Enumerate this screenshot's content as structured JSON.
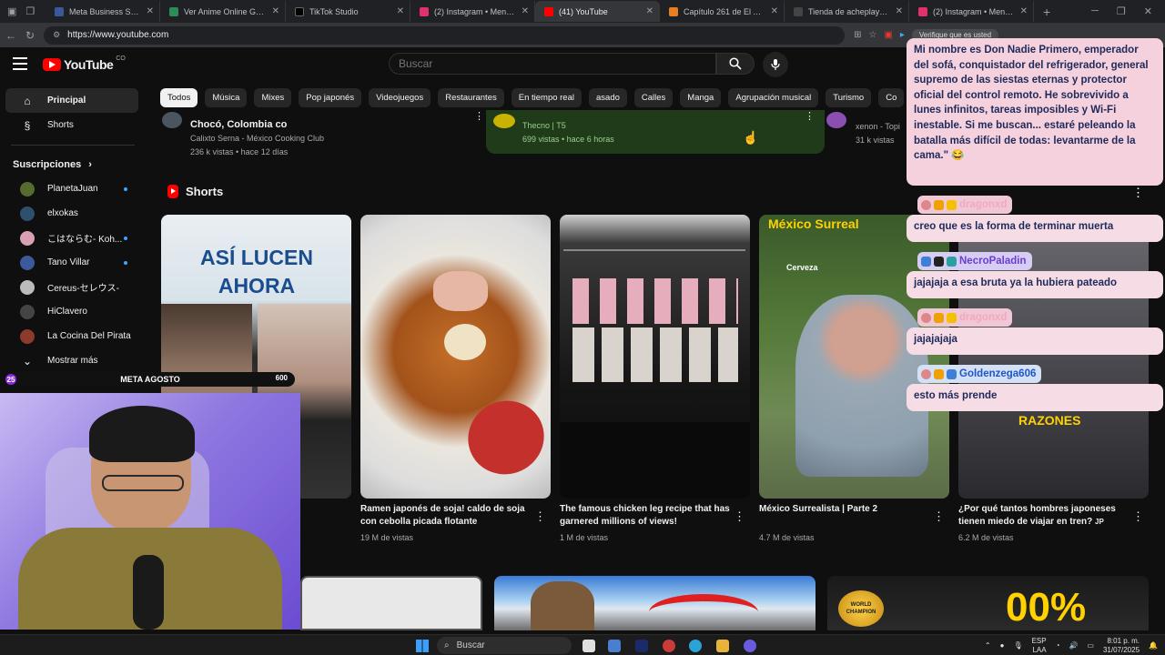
{
  "browser": {
    "tabs": [
      {
        "title": "Meta Business Suite",
        "color": "#3b5998"
      },
      {
        "title": "Ver Anime Online Gratis en",
        "color": "#2e8b57"
      },
      {
        "title": "TikTok Studio",
        "color": "#000000"
      },
      {
        "title": "(2) Instagram • Mensajes",
        "color": "#e1306c"
      },
      {
        "title": "(41) YouTube",
        "color": "#ff0000"
      },
      {
        "title": "Capítulo 261 de El Asesino",
        "color": "#e67e22"
      },
      {
        "title": "Tienda de acheplaysworld",
        "color": "#444444"
      },
      {
        "title": "(2) Instagram • Mensajes",
        "color": "#e1306c"
      }
    ],
    "active_tab": 4,
    "url": "https://www.youtube.com",
    "verify_label": "Verifique que es usted",
    "chat_label": "Chat"
  },
  "youtube": {
    "logo_text": "YouTube",
    "country_code": "CO",
    "search_placeholder": "Buscar",
    "sidebar": {
      "main": [
        {
          "label": "Principal",
          "icon": "home-icon",
          "active": true
        },
        {
          "label": "Shorts",
          "icon": "shorts-icon",
          "active": false
        }
      ],
      "subscriptions_title": "Suscripciones",
      "subscriptions": [
        {
          "label": "PlanetaJuan",
          "color": "#556b2f",
          "dot": true
        },
        {
          "label": "elxokas",
          "color": "#2f4f6f",
          "dot": false
        },
        {
          "label": "こはならむ- Koh...",
          "color": "#d8a0b0",
          "dot": true
        },
        {
          "label": "Tano Villar",
          "color": "#3c5a99",
          "dot": true
        },
        {
          "label": "Cereus-セレウス-",
          "color": "#bbbbbb",
          "dot": false
        },
        {
          "label": "HiClavero",
          "color": "#444444",
          "dot": false
        },
        {
          "label": "La Cocina Del Pirata",
          "color": "#8b3a2b",
          "dot": false
        }
      ],
      "show_more": "Mostrar más"
    },
    "chips": [
      "Todos",
      "Música",
      "Mixes",
      "Pop japonés",
      "Videojuegos",
      "Restaurantes",
      "En tiempo real",
      "asado",
      "Calles",
      "Manga",
      "Agrupación musical",
      "Turismo",
      "Co"
    ],
    "top_row": [
      {
        "title": "Chocó, Colombia co",
        "channel": "Calixto Serna - México Cooking Club",
        "views": "236 k vistas • hace 12 días"
      },
      {
        "channel": "Thecno | T5",
        "views": "699 vistas • hace 6 horas"
      },
      {
        "channel": "xenon - Topi",
        "views": "31 k vistas"
      }
    ],
    "shorts_title": "Shorts",
    "shorts": [
      {
        "title": "",
        "views": "",
        "overlay": "ASÍ LUCEN AHORA"
      },
      {
        "title": "Ramen japonés de soja! caldo de soja con cebolla picada flotante",
        "views": "19 M de vistas"
      },
      {
        "title": "The famous chicken leg recipe that has garnered millions of views!",
        "views": "1 M de vistas"
      },
      {
        "title": "México Surrealista | Parte 2",
        "views": "4.7 M de vistas",
        "overlay": "México Surreal",
        "tag": "Cerveza"
      },
      {
        "title": "¿Por qué tantos hombres japoneses tienen miedo de viajar en tren?",
        "title_suffix": "JP",
        "views": "6.2 M de vistas",
        "overlay": "RAZONES"
      }
    ],
    "bottom_badge": "WORLD CHAMPION",
    "bottom_text": "00%"
  },
  "stream": {
    "goal_label": "META AGOSTO",
    "goal_current": "25",
    "goal_target": "600",
    "chat": [
      {
        "user": "",
        "text": "Mi nombre es Don Nadie Primero, emperador del sofá, conquistador del refrigerador, general supremo de las siestas eternas y protector oficial del control remoto. He sobrevivido a lunes infinitos, tareas imposibles y Wi-Fi inestable. Si me buscan... estaré peleando la batalla más difícil de todas: levantarme de la cama.\" 😂"
      },
      {
        "user": "dragonxd",
        "text": "creo que es la forma de terminar muerta",
        "name_color": "#f0c7d4",
        "text_color": "#f4a8c0"
      },
      {
        "user": "NecroPaladin",
        "text": "jajajaja a esa bruta ya la hubiera pateado",
        "name_color": "#b9a6f0",
        "text_color": "#6a3fd1"
      },
      {
        "user": "dragonxd",
        "text": "jajajajaja",
        "name_color": "#f0c7d4",
        "text_color": "#f4a8c0"
      },
      {
        "user": "Goldenzega606",
        "text": "esto más prende",
        "name_color": "#a8c4f0",
        "text_color": "#1f57c8"
      }
    ]
  },
  "taskbar": {
    "search_label": "Buscar",
    "lang_top": "ESP",
    "lang_bottom": "LAA",
    "time": "8:01 p. m.",
    "date": "31/07/2025"
  }
}
